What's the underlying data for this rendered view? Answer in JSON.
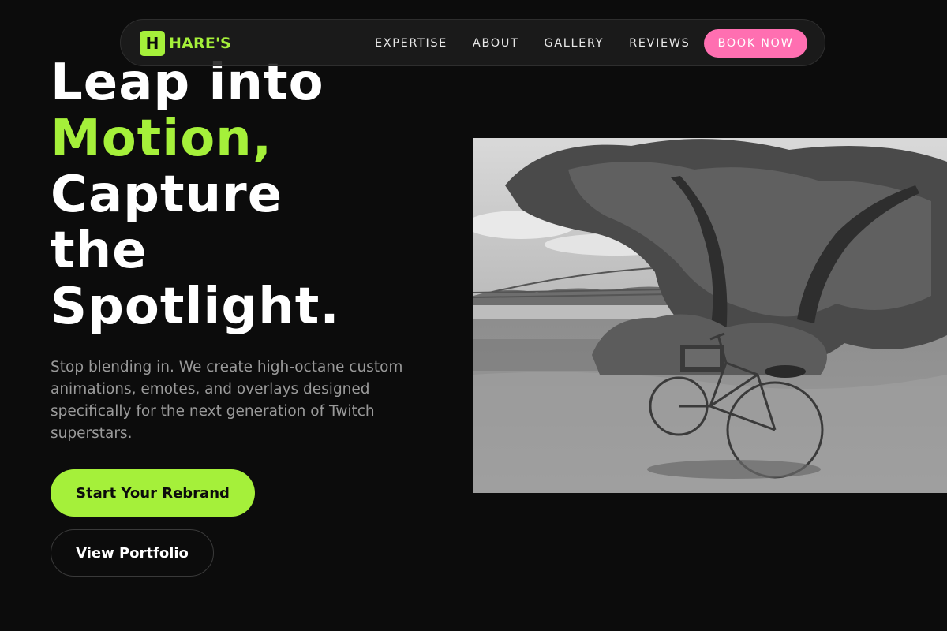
{
  "nav": {
    "logo_mark": "H",
    "logo_text": "HARE'S",
    "links": [
      "EXPERTISE",
      "ABOUT",
      "GALLERY",
      "REVIEWS"
    ],
    "cta_label": "BOOK NOW"
  },
  "hero": {
    "headline": {
      "line1": "Leap into",
      "line2": "Motion,",
      "line3": "Capture",
      "line4": "the",
      "line5": "Spotlight."
    },
    "subtext": "Stop blending in. We create high-octane custom animations, emotes, and overlays designed specifically for the next generation of Twitch superstars.",
    "primary_button": "Start Your Rebrand",
    "secondary_button": "View Portfolio"
  },
  "image": {
    "subject": "bicycle-under-tree-photo"
  },
  "colors": {
    "background": "#0c0c0c",
    "accent_green": "#a5f03a",
    "accent_pink": "#ff6fb1",
    "muted_text": "#9a9a9a"
  }
}
